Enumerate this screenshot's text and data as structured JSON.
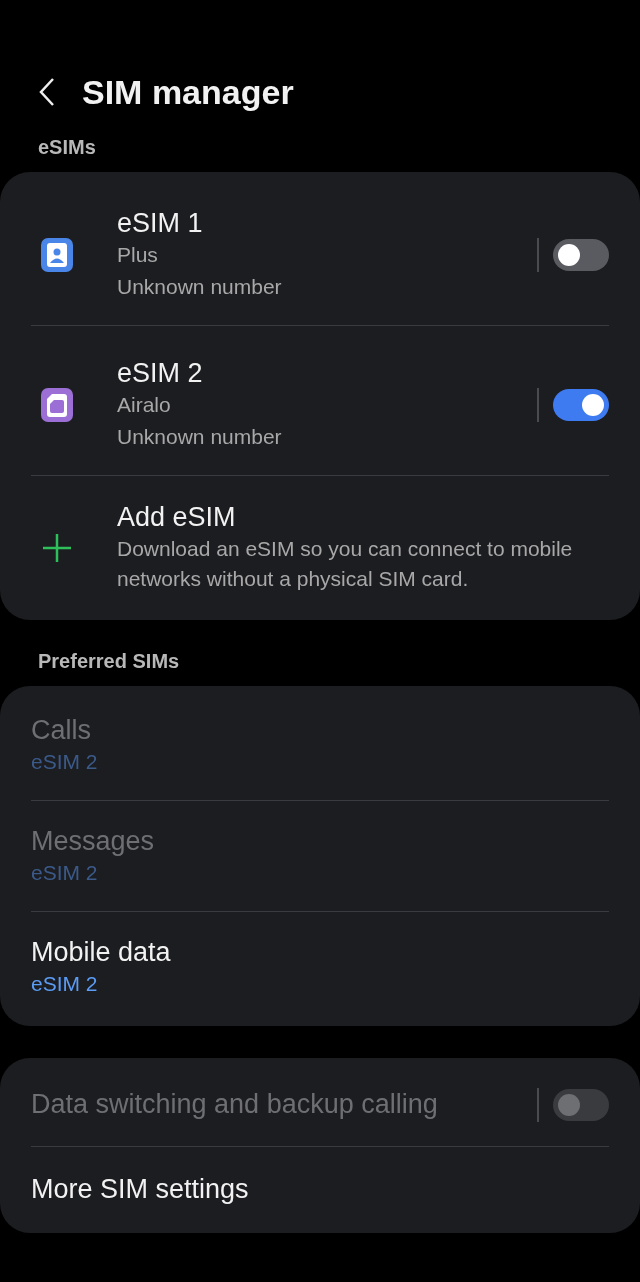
{
  "header": {
    "title": "SIM manager"
  },
  "esims": {
    "label": "eSIMs",
    "items": [
      {
        "kind": "sim",
        "name": "eSIM 1",
        "carrier": "Plus",
        "number": "Unknown number",
        "color": "#4a86e8",
        "on": false
      },
      {
        "kind": "sim",
        "name": "eSIM 2",
        "carrier": "Airalo",
        "number": "Unknown number",
        "color": "#9b6fd6",
        "on": true
      },
      {
        "kind": "add",
        "name": "Add eSIM",
        "description": "Download an eSIM so you can connect to mobile networks without a physical SIM card."
      }
    ]
  },
  "preferred": {
    "label": "Preferred SIMs",
    "items": [
      {
        "title": "Calls",
        "value": "eSIM 2",
        "disabled": true
      },
      {
        "title": "Messages",
        "value": "eSIM 2",
        "disabled": true
      },
      {
        "title": "Mobile data",
        "value": "eSIM 2",
        "disabled": false
      }
    ]
  },
  "more": {
    "items": [
      {
        "kind": "switch",
        "title": "Data switching and backup calling",
        "disabled": true,
        "on": false
      },
      {
        "kind": "link",
        "title": "More SIM settings",
        "disabled": false
      }
    ]
  }
}
